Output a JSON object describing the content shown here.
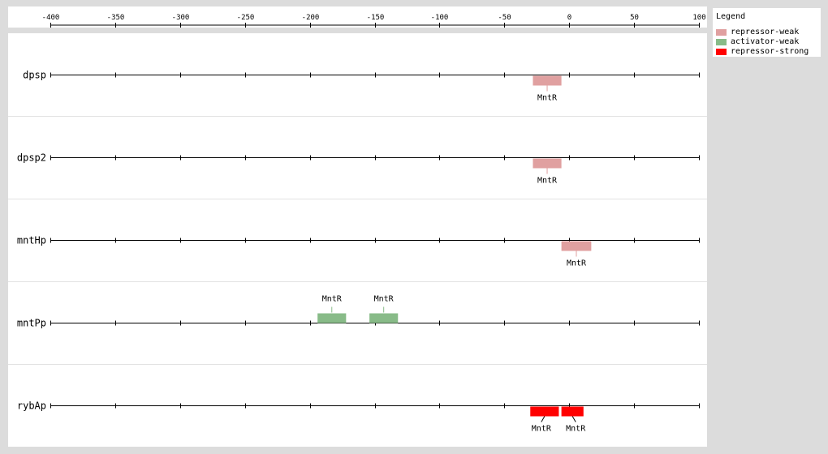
{
  "axis": {
    "ticks": [
      -400,
      -350,
      -300,
      -250,
      -200,
      -150,
      -100,
      -50,
      0,
      50,
      100
    ],
    "tick_labels": [
      "-400",
      "-350",
      "-300",
      "-250",
      "-200",
      "-150",
      "-100",
      "-50",
      "0",
      "50",
      "100"
    ],
    "min": -400,
    "max": 100
  },
  "legend": {
    "title": "Legend",
    "items": [
      {
        "label": "repressor-weak",
        "color": "#e0a0a0"
      },
      {
        "label": "activator-weak",
        "color": "#88bb88"
      },
      {
        "label": "repressor-strong",
        "color": "#ff0000"
      }
    ]
  },
  "tracks": [
    {
      "label": "dpsp",
      "sites": [
        {
          "name": "MntR",
          "start": -28,
          "end": -6,
          "type": "repressor-weak",
          "side": "below"
        }
      ]
    },
    {
      "label": "dpsp2",
      "sites": [
        {
          "name": "MntR",
          "start": -28,
          "end": -6,
          "type": "repressor-weak",
          "side": "below"
        }
      ]
    },
    {
      "label": "mntHp",
      "sites": [
        {
          "name": "MntR",
          "start": -6,
          "end": 17,
          "type": "repressor-weak",
          "side": "below"
        }
      ]
    },
    {
      "label": "mntPp",
      "sites": [
        {
          "name": "MntR",
          "start": -194,
          "end": -172,
          "type": "activator-weak",
          "side": "above"
        },
        {
          "name": "MntR",
          "start": -154,
          "end": -132,
          "type": "activator-weak",
          "side": "above"
        }
      ]
    },
    {
      "label": "rybAp",
      "sites": [
        {
          "name": "MntR",
          "start": -30,
          "end": -8,
          "type": "repressor-strong",
          "side": "below",
          "label_dx": -4
        },
        {
          "name": "MntR",
          "start": -6,
          "end": 11,
          "type": "repressor-strong",
          "side": "below",
          "label_dx": 4
        }
      ]
    }
  ]
}
